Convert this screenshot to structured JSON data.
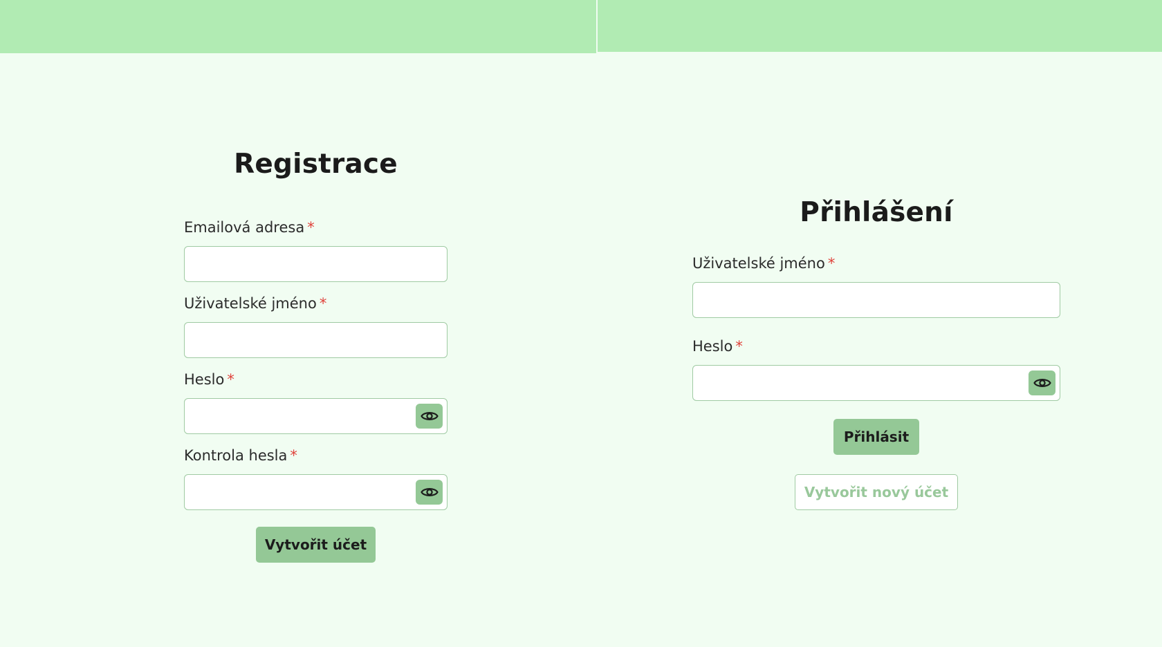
{
  "register": {
    "title": "Registrace",
    "email_label": "Emailová adresa",
    "username_label": "Uživatelské jméno",
    "password_label": "Heslo",
    "password_confirm_label": "Kontrola hesla",
    "required_mark": "*",
    "submit_label": "Vytvořit účet"
  },
  "login": {
    "title": "Přihlášení",
    "username_label": "Uživatelské jméno",
    "password_label": "Heslo",
    "required_mark": "*",
    "submit_label": "Přihlásit",
    "create_account_label": "Vytvořit nový účet"
  },
  "icons": {
    "toggle_password": "eye-icon"
  },
  "colors": {
    "header": "#b1ebb3",
    "background": "#f1fdf2",
    "accent": "#94c896",
    "border": "#9fcaa2",
    "required": "#e0423b"
  }
}
